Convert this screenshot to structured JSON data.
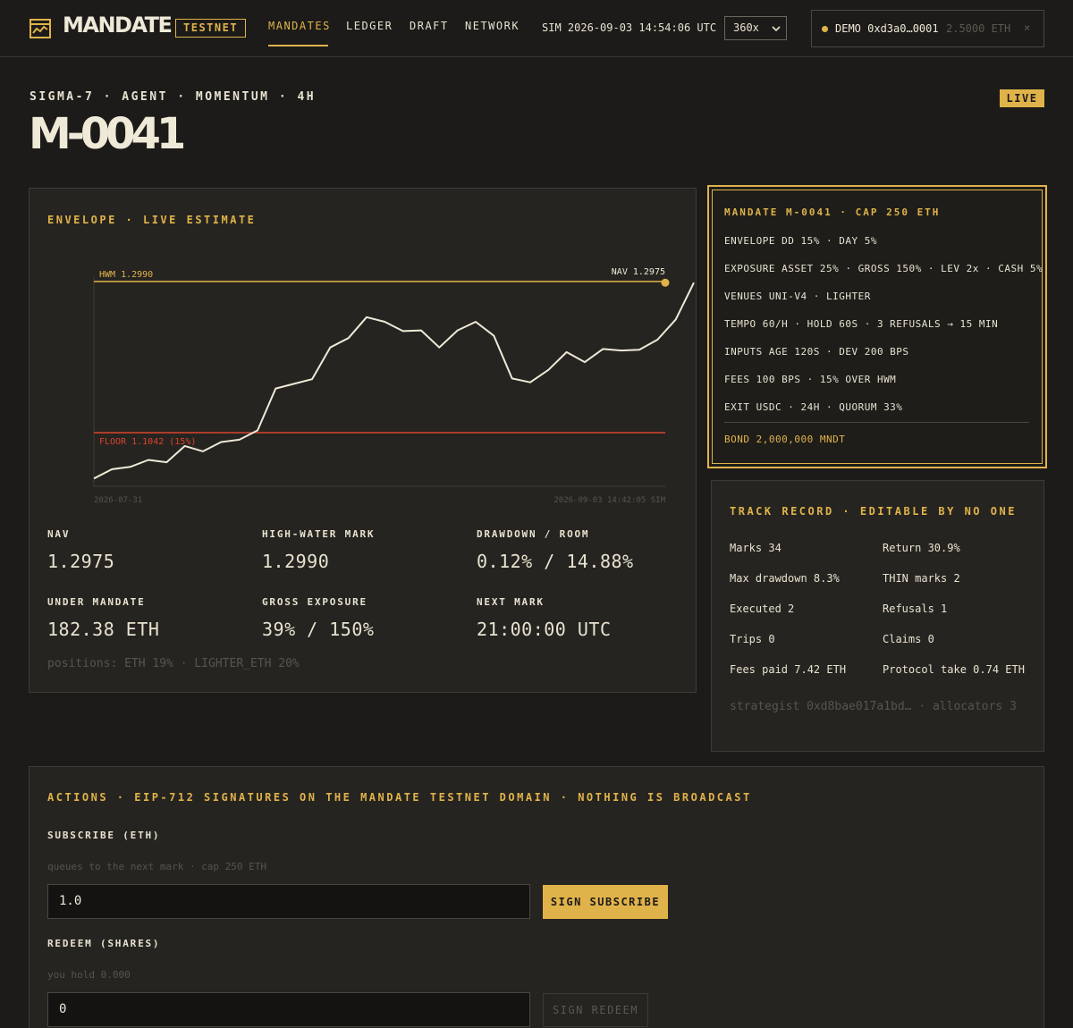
{
  "app": {
    "brand": "MANDATE",
    "network_badge": "TESTNET",
    "nav": [
      "MANDATES",
      "LEDGER",
      "DRAFT",
      "NETWORK"
    ],
    "active_nav": "MANDATES",
    "sim_time": "SIM 2026-09-03 14:54:06 UTC",
    "speed": "360x",
    "wallet": {
      "address": "DEMO 0xd3a0…0001",
      "balance": "2.5000 ETH",
      "close": "×"
    },
    "accent": "#e0b34a"
  },
  "header": {
    "subtitle": "SIGMA-7 · AGENT · MOMENTUM · 4H",
    "title": "M-0041",
    "status": "LIVE"
  },
  "chart_panel": {
    "heading": "ENVELOPE · LIVE ESTIMATE",
    "stats": [
      {
        "label": "NAV",
        "value": "1.2975"
      },
      {
        "label": "HIGH-WATER MARK",
        "value": "1.2990"
      },
      {
        "label": "DRAWDOWN / ROOM",
        "value": "0.12% / 14.88%"
      },
      {
        "label": "UNDER MANDATE",
        "value": "182.38 ETH"
      },
      {
        "label": "GROSS EXPOSURE",
        "value": "39% / 150%"
      },
      {
        "label": "NEXT MARK",
        "value": "21:00:00 UTC"
      }
    ],
    "positions": "positions: ETH 19% · LIGHTER_ETH 20%"
  },
  "chart_data": {
    "type": "line",
    "title": "",
    "xlabel": "",
    "ylabel": "",
    "x_start_label": "2026-07-31",
    "x_end_label": "2026-09-03 14:42:05 SIM",
    "ylim": [
      1.035,
      1.315
    ],
    "hwm": {
      "label": "HWM 1.2990",
      "value": 1.299,
      "color": "#e0b34a"
    },
    "floor": {
      "label": "FLOOR 1.1042 (15%)",
      "value": 1.1042,
      "color": "#d9442c"
    },
    "nav_label": "NAV 1.2975",
    "series": [
      {
        "color": "#efe9d8",
        "values": [
          1.045,
          1.057,
          1.06,
          1.069,
          1.066,
          1.087,
          1.08,
          1.092,
          1.095,
          1.107,
          1.161,
          1.167,
          1.173,
          1.214,
          1.226,
          1.253,
          1.247,
          1.235,
          1.236,
          1.214,
          1.236,
          1.247,
          1.229,
          1.174,
          1.169,
          1.185,
          1.208,
          1.195,
          1.212,
          1.21,
          1.211,
          1.224,
          1.25,
          1.2975
        ]
      }
    ],
    "grid": false,
    "legend": "none"
  },
  "mandate": {
    "heading": "MANDATE M-0041 · CAP 250 ETH",
    "terms": [
      "ENVELOPE DD 15% · DAY 5%",
      "EXPOSURE ASSET 25% · GROSS 150% · LEV 2x · CASH 5%",
      "VENUES UNI-V4 · LIGHTER",
      "TEMPO 60/H · HOLD 60S · 3 REFUSALS → 15 MIN",
      "INPUTS AGE 120S · DEV 200 BPS",
      "FEES 100 BPS · 15% OVER HWM",
      "EXIT USDC · 24H · QUORUM 33%"
    ],
    "bond": "BOND 2,000,000 MNDT"
  },
  "track": {
    "heading": "TRACK RECORD · EDITABLE BY NO ONE",
    "items": [
      "Marks 34",
      "Return 30.9%",
      "Max drawdown 8.3%",
      "THIN marks 2",
      "Executed 2",
      "Refusals 1",
      "Trips 0",
      "Claims 0",
      "Fees paid 7.42 ETH",
      "Protocol take 0.74 ETH"
    ],
    "strategist": "strategist 0xd8bae017a1bd… · allocators 3"
  },
  "actions": {
    "heading": "ACTIONS · EIP-712 SIGNATURES ON THE MANDATE TESTNET DOMAIN · NOTHING IS BROADCAST",
    "subscribe": {
      "label": "SUBSCRIBE (ETH)",
      "hint": "queues to the next mark · cap 250 ETH",
      "value": "1.0",
      "button": "SIGN SUBSCRIBE"
    },
    "redeem": {
      "label": "REDEEM (SHARES)",
      "hint": "you hold 0.000",
      "value": "0",
      "button": "SIGN REDEEM"
    }
  }
}
